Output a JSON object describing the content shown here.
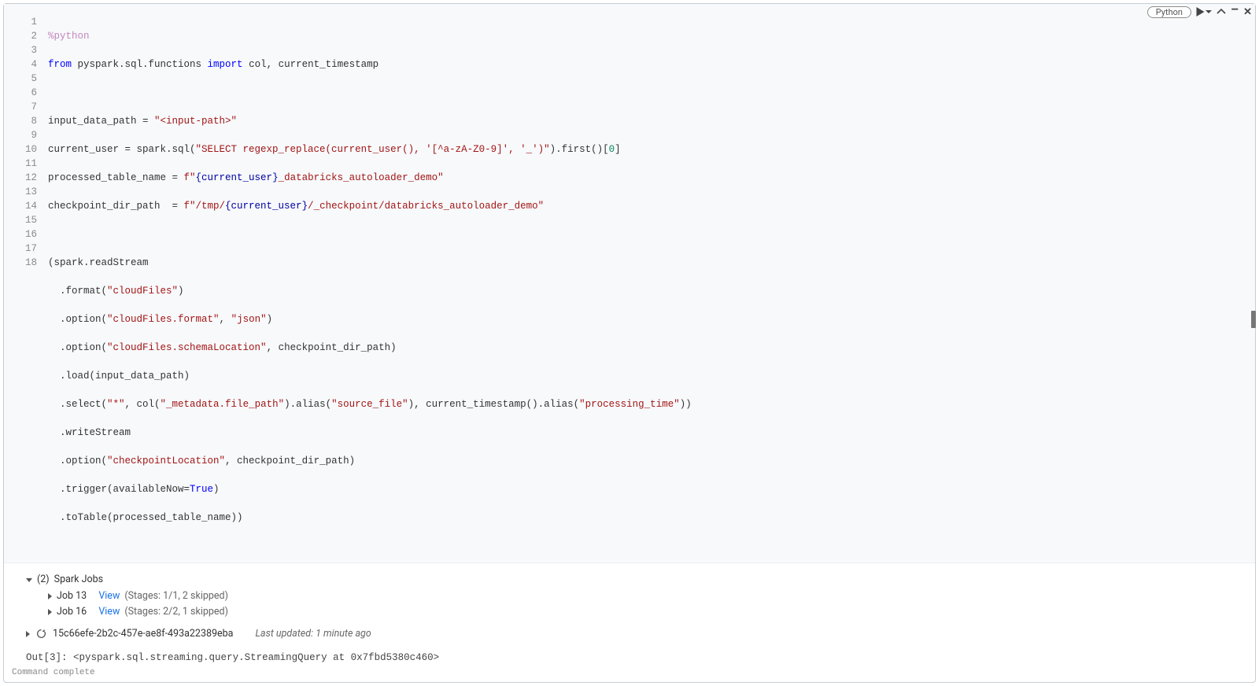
{
  "toolbar": {
    "language": "Python"
  },
  "code": {
    "line_count": 18,
    "lines": {
      "l1_magic": "%python",
      "l2_from": "from",
      "l2_mod": " pyspark.sql.functions ",
      "l2_import": "import",
      "l2_names": " col, current_timestamp",
      "l4_var": "input_data_path = ",
      "l4_s1": "\"<input-path>\"",
      "l5_a": "current_user = spark.sql(",
      "l5_s1": "\"SELECT regexp_replace(current_user(), '[^a-zA-Z0-9]', '_')\"",
      "l5_b": ").first()[",
      "l5_n": "0",
      "l5_c": "]",
      "l6_a": "processed_table_name = ",
      "l6_s": "f\"",
      "l6_i1": "{current_user}",
      "l6_s2": "_databricks_autoloader_demo\"",
      "l7_a": "checkpoint_dir_path  = ",
      "l7_s": "f\"/tmp/",
      "l7_i1": "{current_user}",
      "l7_s2": "/_checkpoint/databricks_autoloader_demo\"",
      "l9": "(spark.readStream",
      "l10a": "  .format(",
      "l10s": "\"cloudFiles\"",
      "l10b": ")",
      "l11a": "  .option(",
      "l11s1": "\"cloudFiles.format\"",
      "l11c": ", ",
      "l11s2": "\"json\"",
      "l11b": ")",
      "l12a": "  .option(",
      "l12s1": "\"cloudFiles.schemaLocation\"",
      "l12b": ", checkpoint_dir_path)",
      "l13a": "  .load(input_data_path)",
      "l14a": "  .select(",
      "l14s1": "\"*\"",
      "l14b": ", col(",
      "l14s2": "\"_metadata.file_path\"",
      "l14c": ").alias(",
      "l14s3": "\"source_file\"",
      "l14d": "), current_timestamp().alias(",
      "l14s4": "\"processing_time\"",
      "l14e": "))",
      "l15": "  .writeStream",
      "l16a": "  .option(",
      "l16s1": "\"checkpointLocation\"",
      "l16b": ", checkpoint_dir_path)",
      "l17a": "  .trigger(availableNow=",
      "l17t": "True",
      "l17b": ")",
      "l18": "  .toTable(processed_table_name))"
    }
  },
  "output": {
    "spark_jobs_count": "(2)",
    "spark_jobs_label": "Spark Jobs",
    "jobs": [
      {
        "name": "Job 13",
        "view": "View",
        "stages": "(Stages: 1/1, 2 skipped)"
      },
      {
        "name": "Job 16",
        "view": "View",
        "stages": "(Stages: 2/2, 1 skipped)"
      }
    ],
    "query_id": "15c66efe-2b2c-457e-ae8f-493a22389eba",
    "last_updated": "Last updated: 1 minute ago",
    "out_label": "Out[3]:",
    "out_value": "<pyspark.sql.streaming.query.StreamingQuery at 0x7fbd5380c460>",
    "status": "Command complete"
  }
}
